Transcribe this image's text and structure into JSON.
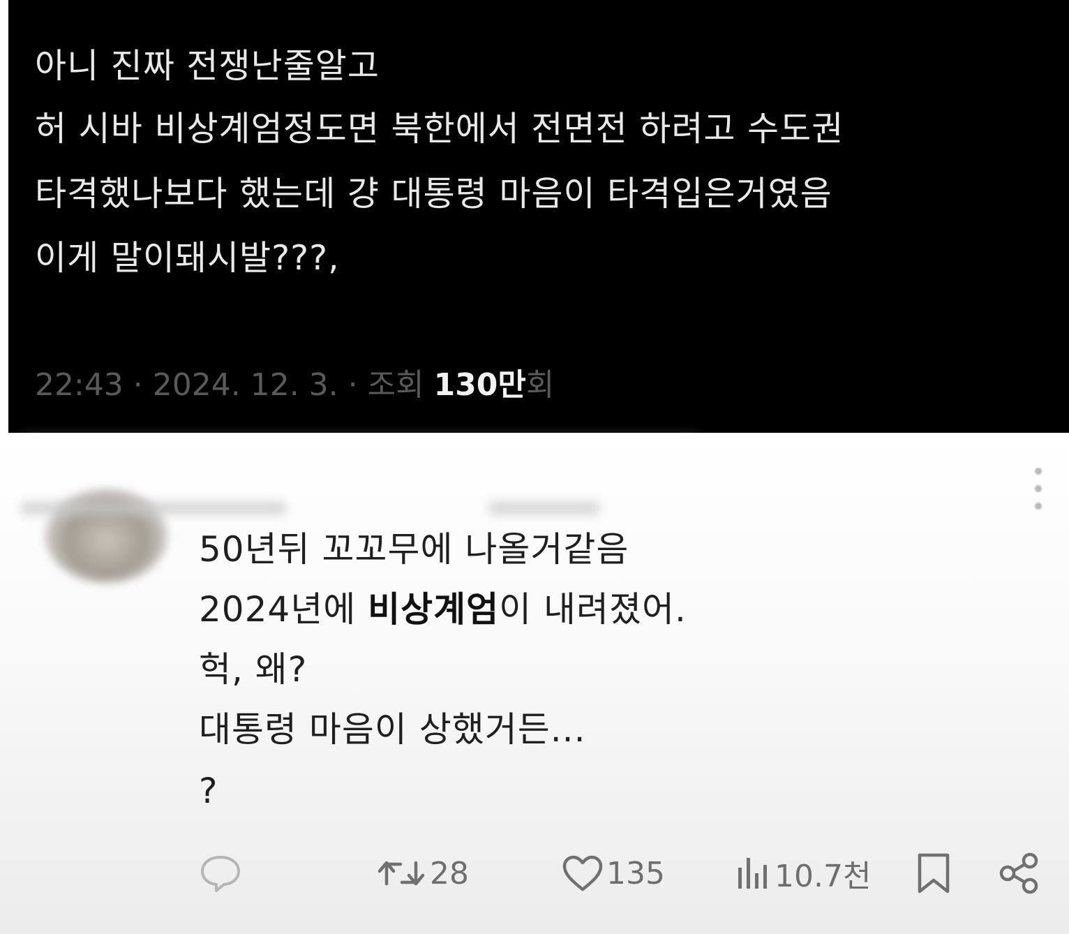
{
  "tweet": {
    "lines": [
      "아니 진짜 전쟁난줄알고",
      "허 시바 비상계엄정도면 북한에서 전면전 하려고 수도권",
      "타격했나보다 했는데 걍 대통령 마음이 타격입은거였음",
      "이게 말이돼시발???,"
    ],
    "meta_prefix": "22:43 · 2024. 12. 3. · 조회 ",
    "views_number": "130만",
    "views_suffix": "회"
  },
  "reply": {
    "line1": "50년뒤 꼬꼬무에 나올거같음",
    "line2_pre": "2024년에 ",
    "line2_bold": "비상계엄",
    "line2_post": "이 내려졌어.",
    "line3": "헉, 왜?",
    "line4": "대통령 마음이 상했거든...",
    "line5": "?"
  },
  "actions": {
    "reply_icon": "comment-icon",
    "retweet_icon": "retweet-icon",
    "retweets": "28",
    "like_icon": "heart-icon",
    "likes": "135",
    "views_icon": "bar-chart-icon",
    "views": "10.7천",
    "bookmark_icon": "bookmark-icon",
    "share_icon": "share-icon"
  },
  "colors": {
    "top_bg": "#000000",
    "top_text": "#e9e9e9",
    "meta_text": "#5a5a5a",
    "reply_text": "#1f1f1f",
    "icon_gray": "#707070"
  }
}
